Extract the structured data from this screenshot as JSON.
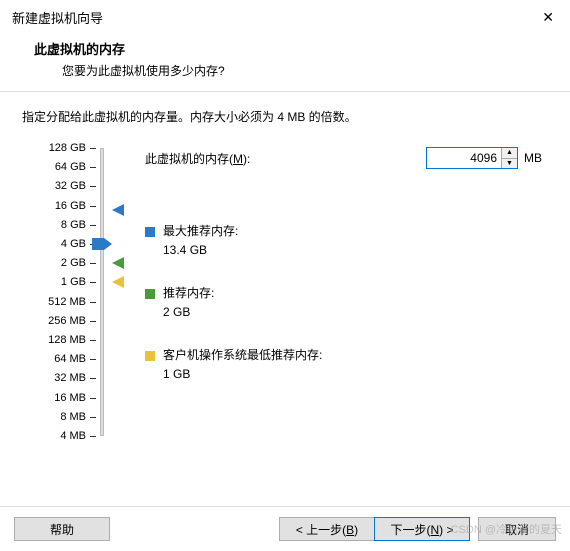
{
  "window": {
    "title": "新建虚拟机向导"
  },
  "header": {
    "title": "此虚拟机的内存",
    "subtitle": "您要为此虚拟机使用多少内存?"
  },
  "instruction": "指定分配给此虚拟机的内存量。内存大小必须为 4 MB 的倍数。",
  "memory": {
    "label_prefix": "此虚拟机的内存(",
    "label_key": "M",
    "label_suffix": "):",
    "value": "4096",
    "unit": "MB"
  },
  "scale": {
    "ticks": [
      "128 GB",
      "64 GB",
      "32 GB",
      "16 GB",
      "8 GB",
      "4 GB",
      "2 GB",
      "1 GB",
      "512 MB",
      "256 MB",
      "128 MB",
      "64 MB",
      "32 MB",
      "16 MB",
      "8 MB",
      "4 MB"
    ]
  },
  "legend": {
    "max": {
      "label": "最大推荐内存:",
      "value": "13.4 GB"
    },
    "rec": {
      "label": "推荐内存:",
      "value": "2 GB"
    },
    "min": {
      "label": "客户机操作系统最低推荐内存:",
      "value": "1 GB"
    }
  },
  "buttons": {
    "help": "帮助",
    "back_prefix": "< 上一步(",
    "back_key": "B",
    "back_suffix": ")",
    "next_prefix": "下一步(",
    "next_key": "N",
    "next_suffix": ") >",
    "cancel": "取消"
  },
  "watermark": "CSDN @冷色调的夏天"
}
